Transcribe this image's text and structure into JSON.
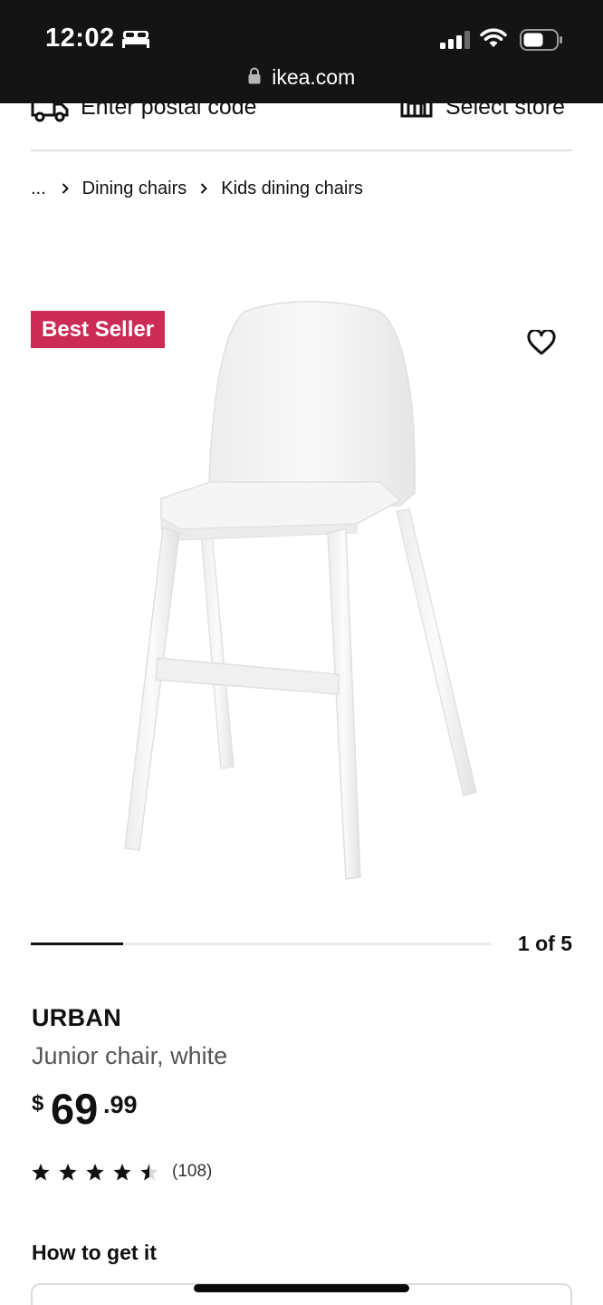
{
  "status_bar": {
    "time": "12:02",
    "url": "ikea.com",
    "icons": [
      "bed-icon",
      "cellular-signal-icon",
      "wifi-icon",
      "battery-icon",
      "lock-icon"
    ]
  },
  "header": {
    "postal_label": "Enter postal code",
    "store_label": "Select store",
    "icons": [
      "delivery-truck-icon",
      "store-icon"
    ]
  },
  "breadcrumb": {
    "ellipsis": "...",
    "items": [
      {
        "label": "Dining chairs"
      },
      {
        "label": "Kids dining chairs"
      }
    ]
  },
  "product": {
    "badge": "Best Seller",
    "image_counter": "1 of 5",
    "image_progress_fraction": 0.2,
    "name": "URBAN",
    "description": "Junior chair, white",
    "price": {
      "currency": "$",
      "integer": "69",
      "decimal": ".99"
    },
    "rating": {
      "value": 4.5,
      "max": 5,
      "review_count": "(108)"
    },
    "favourite_icon": "heart-outline-icon"
  },
  "availability": {
    "heading": "How to get it"
  },
  "colors": {
    "status_bar_bg": "#141414",
    "badge_bg": "#cc2b55",
    "text_primary": "#111111",
    "text_secondary": "#555555"
  }
}
